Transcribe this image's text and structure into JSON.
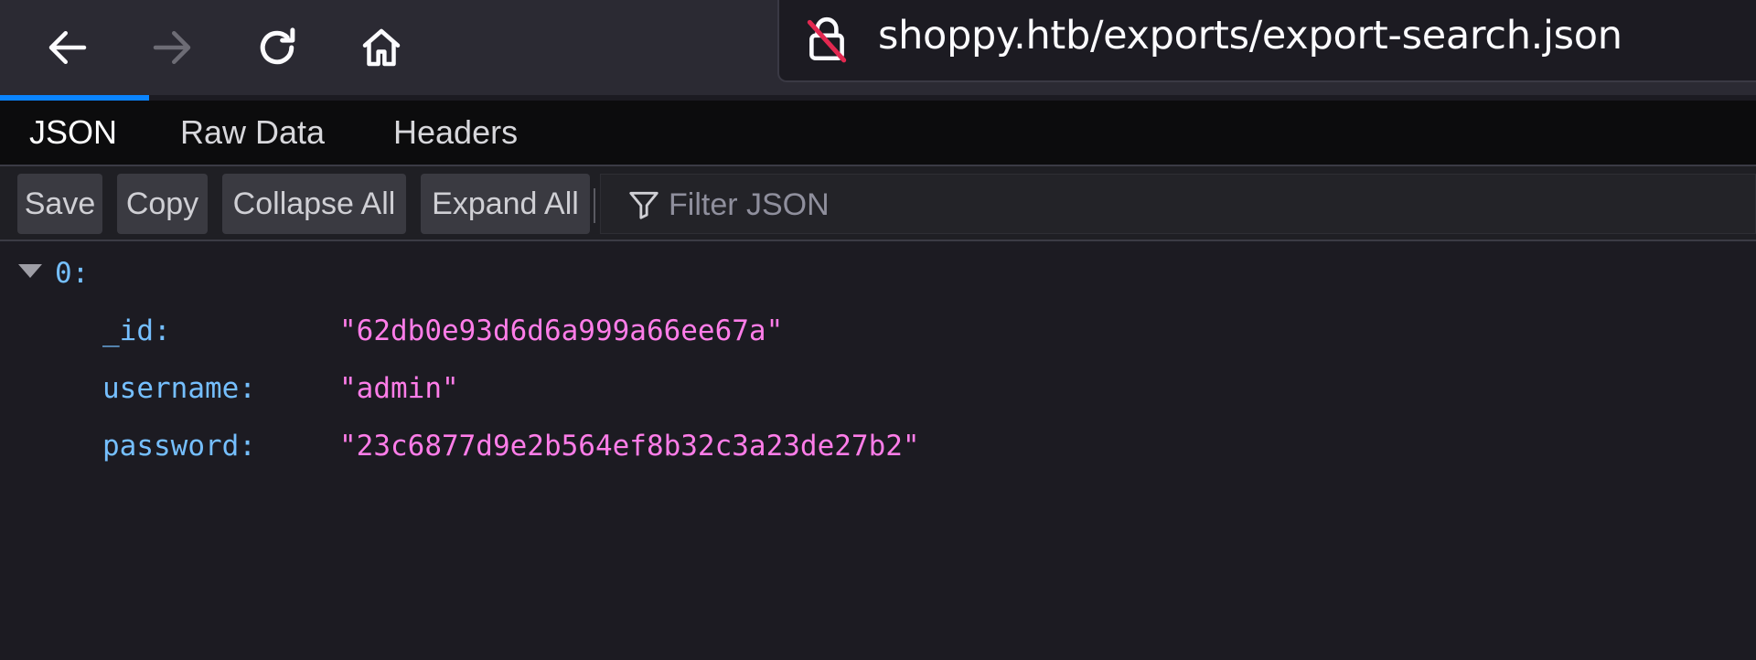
{
  "nav": {
    "back_icon": "back-arrow-icon",
    "forward_icon": "forward-arrow-icon",
    "reload_icon": "reload-icon",
    "home_icon": "home-icon"
  },
  "url": {
    "text": "shoppy.htb/exports/export-search.json",
    "lock_icon": "insecure-lock-icon"
  },
  "tabs": [
    {
      "label": "JSON"
    },
    {
      "label": "Raw Data"
    },
    {
      "label": "Headers"
    }
  ],
  "toolbar": {
    "save_label": "Save",
    "copy_label": "Copy",
    "collapse_label": "Collapse All",
    "expand_label": "Expand All",
    "filter_placeholder": "Filter JSON"
  },
  "json": {
    "root_key": "0:",
    "rows": [
      {
        "key": "_id:",
        "value": "\"62db0e93d6d6a999a66ee67a\""
      },
      {
        "key": "username:",
        "value": "\"admin\""
      },
      {
        "key": "password:",
        "value": "\"23c6877d9e2b564ef8b32c3a23de27b2\""
      }
    ]
  },
  "colors": {
    "accent": "#0a84ff",
    "json_key": "#75bfff",
    "json_string": "#ff7de9",
    "background": "#1c1b22"
  }
}
